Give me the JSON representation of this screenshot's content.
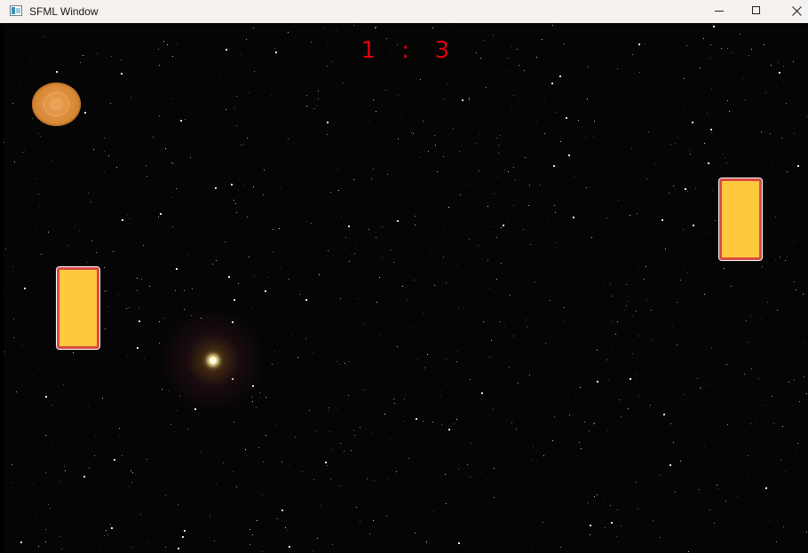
{
  "window": {
    "title": "SFML Window",
    "controls": {
      "minimize": "minimize-icon",
      "maximize": "maximize-icon",
      "close": "close-icon"
    }
  },
  "game": {
    "score": {
      "left": "1",
      "separator": ":",
      "right": "3",
      "color": "#e0000d"
    },
    "background_color": "#050505",
    "paddle_color": "#ffc83d",
    "paddle_border_color": "#d94b45",
    "ball_color": "#d98a38"
  }
}
